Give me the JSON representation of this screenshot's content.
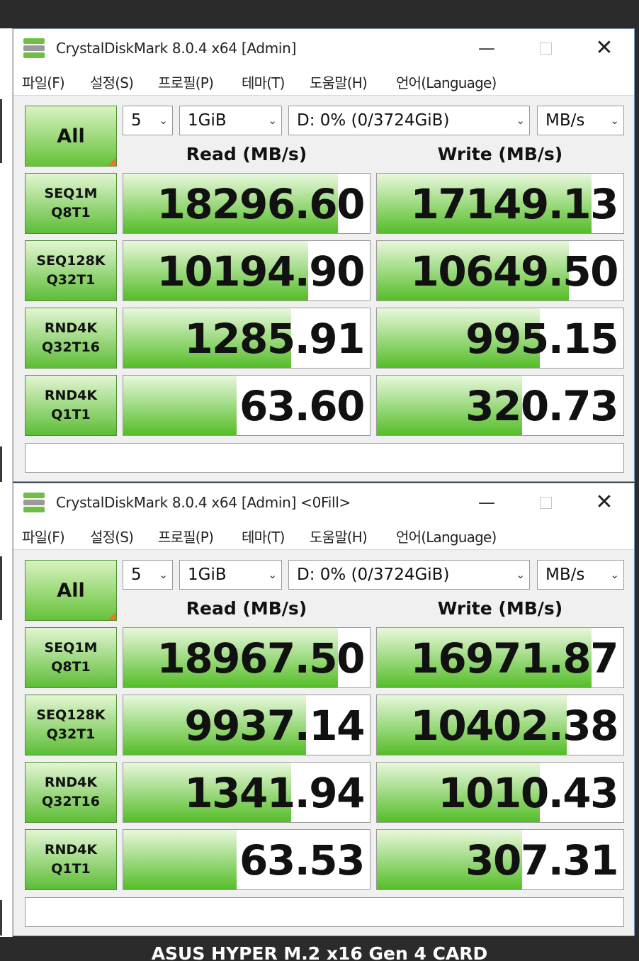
{
  "caption": "ASUS HYPER M.2 x16 Gen 4 CARD",
  "colors": {
    "bar_green": "#55bd28",
    "label_green": "#5dbd36",
    "window_border": "#7a9cc6",
    "corner_orange": "#e8762b"
  },
  "icons": {
    "app": "crystaldiskmark-icon",
    "minimize": "minimize-icon",
    "maximize": "maximize-icon",
    "close": "close-icon",
    "dropdown": "chevron-down-icon"
  },
  "windows": [
    {
      "title": "CrystalDiskMark 8.0.4 x64 [Admin]",
      "menu": [
        "파일(F)",
        "설정(S)",
        "프로필(P)",
        "테마(T)",
        "도움말(H)",
        "언어(Language)"
      ],
      "all_label": "All",
      "selects": {
        "count": "5",
        "size": "1GiB",
        "drive": "D: 0% (0/3724GiB)",
        "unit": "MB/s"
      },
      "read_header": "Read (MB/s)",
      "write_header": "Write (MB/s)",
      "rows": [
        {
          "label1": "SEQ1M",
          "label2": "Q8T1",
          "read": "18296.60",
          "write": "17149.13",
          "read_fill": 0.87,
          "write_fill": 0.87
        },
        {
          "label1": "SEQ128K",
          "label2": "Q32T1",
          "read": "10194.90",
          "write": "10649.50",
          "read_fill": 0.75,
          "write_fill": 0.78
        },
        {
          "label1": "RND4K",
          "label2": "Q32T16",
          "read": "1285.91",
          "write": "995.15",
          "read_fill": 0.68,
          "write_fill": 0.66
        },
        {
          "label1": "RND4K",
          "label2": "Q1T1",
          "read": "63.60",
          "write": "320.73",
          "read_fill": 0.46,
          "write_fill": 0.59
        }
      ],
      "comment": ""
    },
    {
      "title": "CrystalDiskMark 8.0.4 x64 [Admin] <0Fill>",
      "menu": [
        "파일(F)",
        "설정(S)",
        "프로필(P)",
        "테마(T)",
        "도움말(H)",
        "언어(Language)"
      ],
      "all_label": "All",
      "selects": {
        "count": "5",
        "size": "1GiB",
        "drive": "D: 0% (0/3724GiB)",
        "unit": "MB/s"
      },
      "read_header": "Read (MB/s)",
      "write_header": "Write (MB/s)",
      "rows": [
        {
          "label1": "SEQ1M",
          "label2": "Q8T1",
          "read": "18967.50",
          "write": "16971.87",
          "read_fill": 0.87,
          "write_fill": 0.87
        },
        {
          "label1": "SEQ128K",
          "label2": "Q32T1",
          "read": "9937.14",
          "write": "10402.38",
          "read_fill": 0.74,
          "write_fill": 0.77
        },
        {
          "label1": "RND4K",
          "label2": "Q32T16",
          "read": "1341.94",
          "write": "1010.43",
          "read_fill": 0.68,
          "write_fill": 0.66
        },
        {
          "label1": "RND4K",
          "label2": "Q1T1",
          "read": "63.53",
          "write": "307.31",
          "read_fill": 0.46,
          "write_fill": 0.59
        }
      ],
      "comment": ""
    }
  ]
}
